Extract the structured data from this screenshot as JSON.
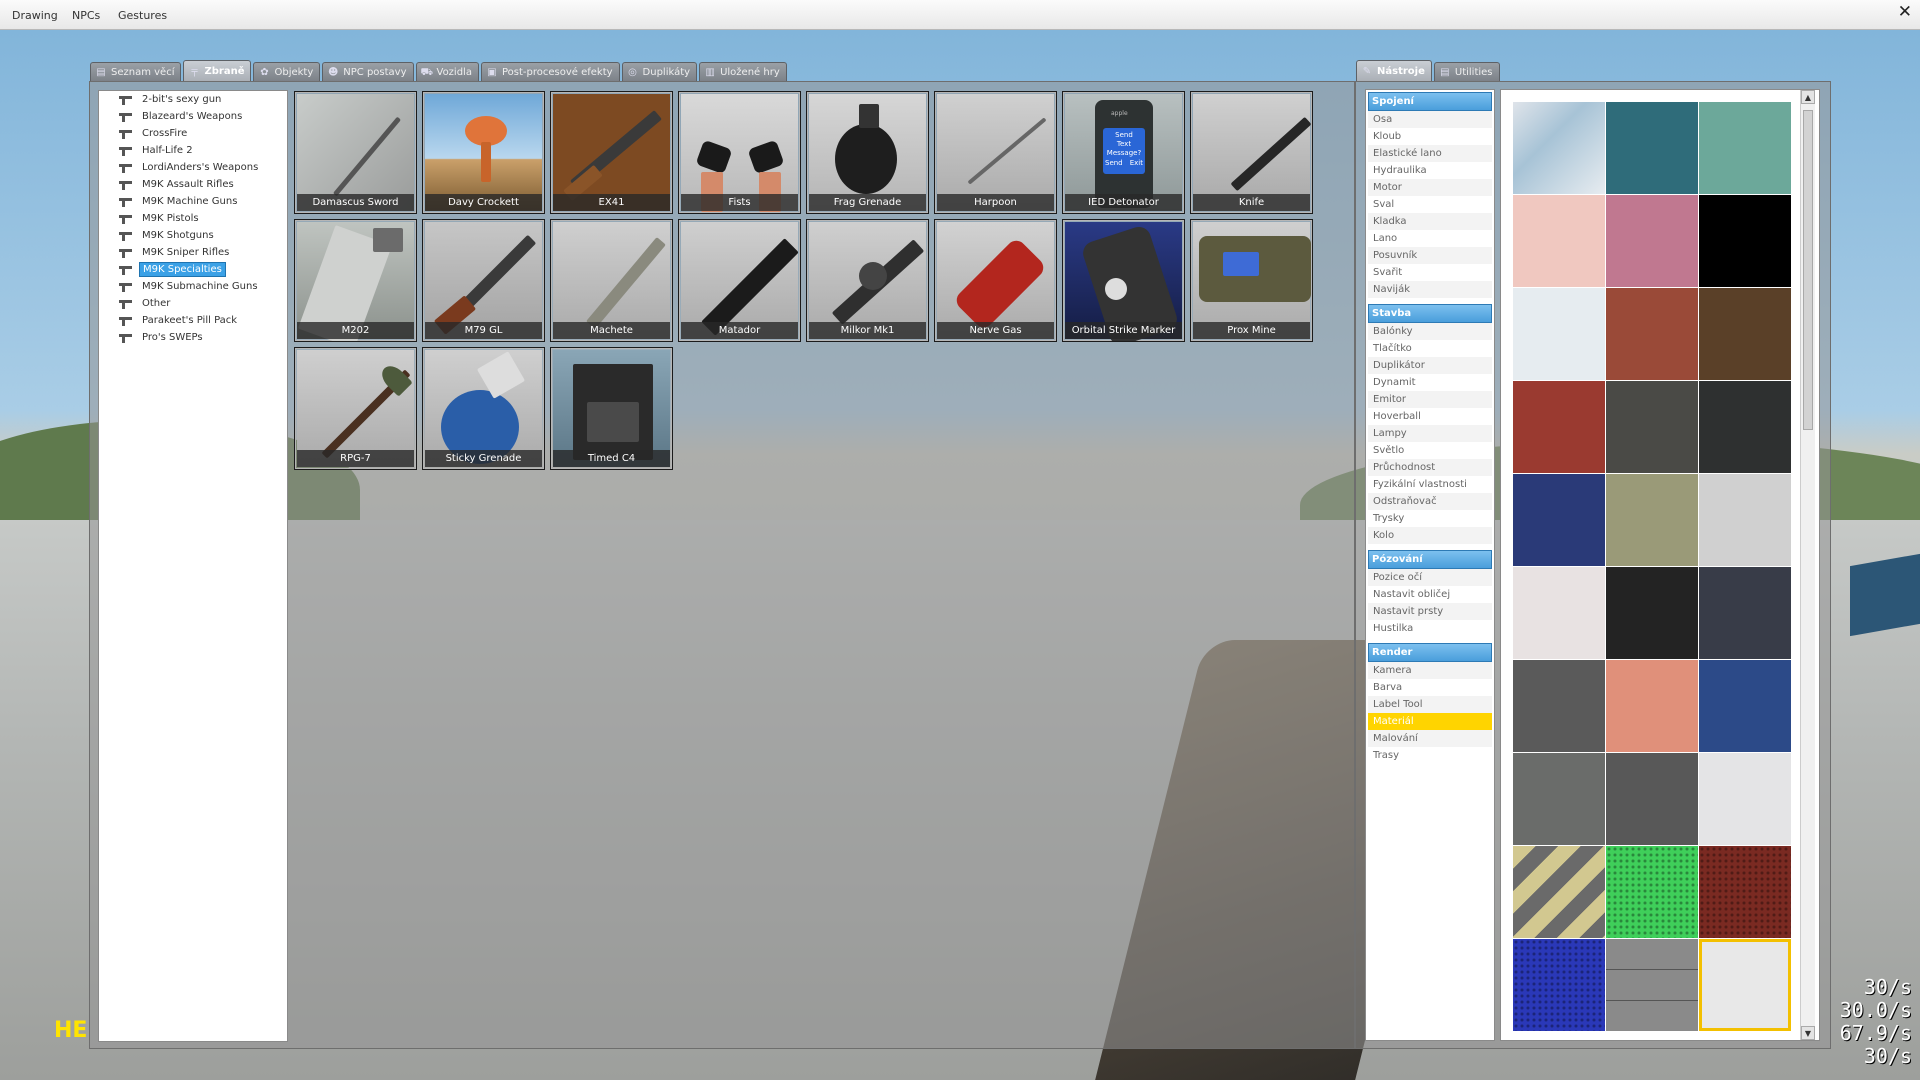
{
  "menubar": {
    "items": [
      "Drawing",
      "NPCs",
      "Gestures"
    ],
    "close": "✕"
  },
  "spawn_tabs": [
    {
      "label": "Seznam věcí",
      "icon": "list-icon"
    },
    {
      "label": "Zbraně",
      "icon": "weapon-icon",
      "active": true
    },
    {
      "label": "Objekty",
      "icon": "entity-icon"
    },
    {
      "label": "NPC postavy",
      "icon": "npc-icon"
    },
    {
      "label": "Vozidla",
      "icon": "vehicle-icon"
    },
    {
      "label": "Post-procesové efekty",
      "icon": "postprocess-icon"
    },
    {
      "label": "Duplikáty",
      "icon": "dupe-icon"
    },
    {
      "label": "Uložené hry",
      "icon": "save-icon"
    }
  ],
  "categories": [
    "2-bit's sexy gun",
    "Blazeard's Weapons",
    "CrossFire",
    "Half-Life 2",
    "LordiAnders's Weapons",
    "M9K Assault Rifles",
    "M9K Machine Guns",
    "M9K Pistols",
    "M9K Shotguns",
    "M9K Sniper Rifles",
    "M9K Specialties",
    "M9K Submachine Guns",
    "Other",
    "Parakeet's Pill Pack",
    "Pro's SWEPs"
  ],
  "selected_category": "M9K Specialties",
  "weapons": [
    {
      "name": "Damascus Sword"
    },
    {
      "name": "Davy Crockett"
    },
    {
      "name": "EX41"
    },
    {
      "name": "Fists"
    },
    {
      "name": "Frag Grenade"
    },
    {
      "name": "Harpoon"
    },
    {
      "name": "IED Detonator"
    },
    {
      "name": "Knife"
    },
    {
      "name": "M202"
    },
    {
      "name": "M79 GL"
    },
    {
      "name": "Machete"
    },
    {
      "name": "Matador"
    },
    {
      "name": "Milkor Mk1"
    },
    {
      "name": "Nerve Gas"
    },
    {
      "name": "Orbital Strike Marker"
    },
    {
      "name": "Prox Mine"
    },
    {
      "name": "RPG-7"
    },
    {
      "name": "Sticky Grenade"
    },
    {
      "name": "Timed C4"
    }
  ],
  "ied_screen": {
    "line1": "Send",
    "line2": "Text",
    "line3": "Message?",
    "send": "Send",
    "exit": "Exit",
    "brand": "apple"
  },
  "tool_tabs": [
    {
      "label": "Nástroje",
      "icon": "wrench-icon",
      "active": true
    },
    {
      "label": "Utilities",
      "icon": "utilities-icon"
    }
  ],
  "tool_groups": [
    {
      "title": "Spojení",
      "tools": [
        "Osa",
        "Kloub",
        "Elastické lano",
        "Hydraulika",
        "Motor",
        "Sval",
        "Kladka",
        "Lano",
        "Posuvník",
        "Svařit",
        "Naviják"
      ]
    },
    {
      "title": "Stavba",
      "tools": [
        "Balónky",
        "Tlačítko",
        "Duplikátor",
        "Dynamit",
        "Emitor",
        "Hoverball",
        "Lampy",
        "Světlo",
        "Průchodnost",
        "Fyzikální vlastnosti",
        "Odstraňovač",
        "Trysky",
        "Kolo"
      ]
    },
    {
      "title": "Pózování",
      "tools": [
        "Pozice očí",
        "Nastavit obličej",
        "Nastavit prsty",
        "Hustilka"
      ]
    },
    {
      "title": "Render",
      "tools": [
        "Kamera",
        "Barva",
        "Label Tool",
        "Materiál",
        "Malování",
        "Trasy"
      ]
    }
  ],
  "selected_tool": "Materiál",
  "materials": [
    "#dfe4ea",
    "#2f6c7a",
    "#6ca89a",
    "#f0c8c0",
    "#c07890",
    "#000000",
    "#e6ecf0",
    "#9a4a38",
    "#5a4028",
    "#9a3a30",
    "#4a4a46",
    "#2e3030",
    "#2a3a78",
    "#9a9a78",
    "#d0d0d0",
    "#e8e2e2",
    "#232323",
    "#383c48",
    "#5a5a5a",
    "#e0907a",
    "#2c4a88",
    "#6a6c6a",
    "#585858",
    "#e4e4e6",
    "#d2c890",
    "#3fcf5a",
    "#7a2a22",
    "#2a38b8",
    "#8a8a8a",
    "#e8e8e8"
  ],
  "selected_material": 29,
  "hud": {
    "text": "HE",
    "fps": [
      "30/s",
      "30.0/s",
      "67.9/s",
      "30/s"
    ]
  }
}
